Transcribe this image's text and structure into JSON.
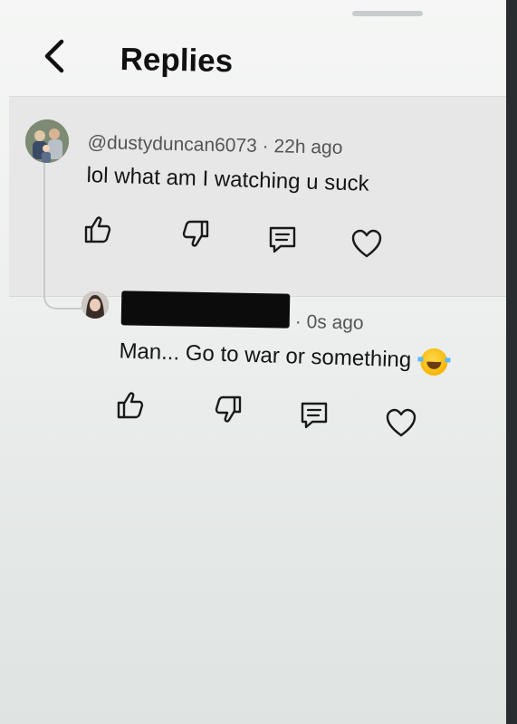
{
  "header": {
    "title": "Replies"
  },
  "icons": {
    "back": "chevron-left-icon",
    "like": "thumbs-up-icon",
    "dislike": "thumbs-down-icon",
    "reply": "comment-icon",
    "heart": "heart-icon"
  },
  "comments": [
    {
      "username": "@dustyduncan6073",
      "time": "22h ago",
      "text": "lol what am I watching u suck"
    },
    {
      "username_redacted": true,
      "time": "0s ago",
      "text": "Man... Go to war or something",
      "emoji": "laughing-tears-emoji"
    }
  ],
  "colors": {
    "text": "#151515",
    "meta": "#555555",
    "parent_bg": "#e6e7e6"
  }
}
